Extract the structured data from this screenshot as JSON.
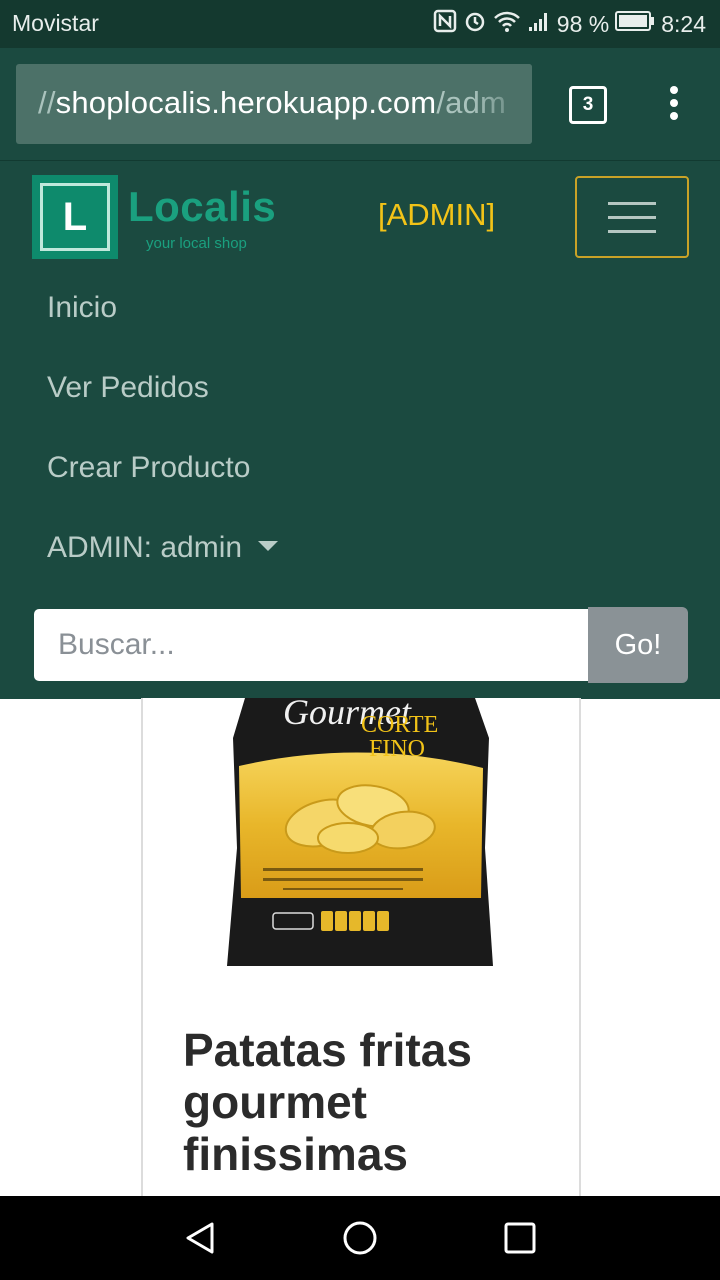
{
  "status_bar": {
    "carrier": "Movistar",
    "battery": "98 %",
    "time": "8:24"
  },
  "browser": {
    "url_prefix": "//",
    "url_main": "shoplocalis.herokuapp.com",
    "url_suffix": "/adm",
    "tab_count": "3"
  },
  "site": {
    "logo_letter": "L",
    "logo_name": "Localis",
    "logo_tagline": "your local shop",
    "admin_label": "[ADMIN]"
  },
  "nav": {
    "items": [
      {
        "label": "Inicio"
      },
      {
        "label": "Ver Pedidos"
      },
      {
        "label": "Crear Producto"
      }
    ],
    "user_menu": "ADMIN: admin"
  },
  "search": {
    "placeholder": "Buscar...",
    "button": "Go!"
  },
  "product": {
    "package_brand": "Gourmet",
    "package_line1": "CORTE",
    "package_line2": "FINO",
    "title": "Patatas fritas gourmet finissimas"
  },
  "colors": {
    "navbar": "#1b4a40",
    "status_bar": "#14392f",
    "admin_accent": "#f2c318",
    "logo_green": "#1aa07f",
    "go_button": "#8a9296"
  }
}
